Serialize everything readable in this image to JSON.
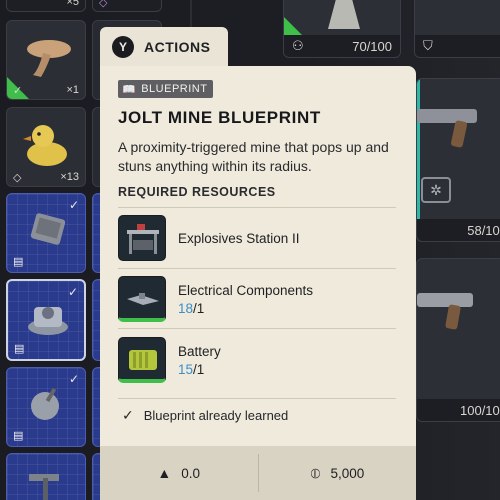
{
  "inventory": {
    "slot_top_count": "×5",
    "slot_mushroom_count": "×1",
    "slot_duck_count": "×13"
  },
  "right_panel": {
    "top_durability": "70/100",
    "weapon1_durability": "58/100",
    "weapon2_durability": "100/100"
  },
  "actions": {
    "button_glyph": "Y",
    "label": "ACTIONS"
  },
  "tooltip": {
    "tag": "BLUEPRINT",
    "title": "JOLT MINE BLUEPRINT",
    "description": "A proximity-triggered mine that pops up and stuns anything within its radius.",
    "required_heading": "REQUIRED RESOURCES",
    "resources": [
      {
        "name": "Explosives Station II",
        "have": "",
        "need": "",
        "icon": "workbench-icon"
      },
      {
        "name": "Electrical Components",
        "have": "18",
        "need": "/1",
        "icon": "electrical-components-icon"
      },
      {
        "name": "Battery",
        "have": "15",
        "need": "/1",
        "icon": "battery-icon"
      }
    ],
    "learned_text": "Blueprint already learned",
    "weight": "0.0",
    "value": "5,000"
  },
  "colors": {
    "card_bg": "#efeadb",
    "accent_blue": "#3a8fc9",
    "rarity_green": "#3fbf4a",
    "blueprint_slot": "#2a3a8c"
  }
}
